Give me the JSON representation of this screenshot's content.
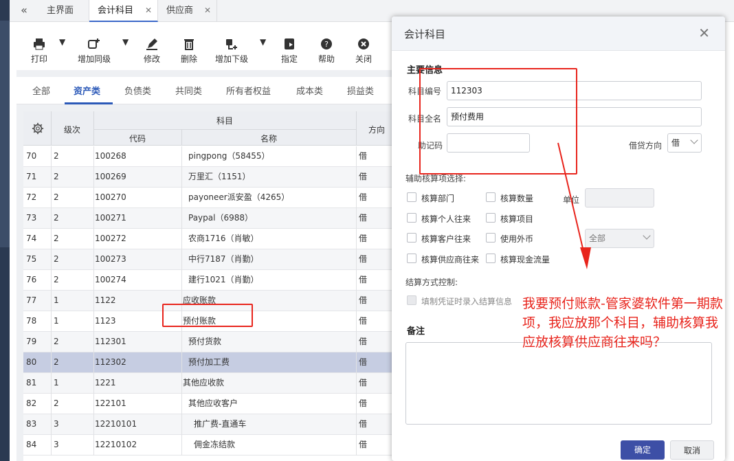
{
  "tabs": [
    {
      "label": "主界面",
      "closable": false
    },
    {
      "label": "会计科目",
      "closable": true,
      "active": true
    },
    {
      "label": "供应商",
      "closable": true
    }
  ],
  "toolbar": {
    "print": "打印",
    "add_same": "增加同级",
    "edit": "修改",
    "delete": "删除",
    "add_child": "增加下级",
    "assign": "指定",
    "help": "帮助",
    "close": "关闭"
  },
  "categories": [
    "全部",
    "资产类",
    "负债类",
    "共同类",
    "所有者权益",
    "成本类",
    "损益类"
  ],
  "grid": {
    "headers": {
      "level": "级次",
      "subject": "科目",
      "code": "代码",
      "name": "名称",
      "direction": "方向"
    },
    "rows": [
      {
        "no": "70",
        "level": "2",
        "code": "100268",
        "name": "pingpong（58455）",
        "dir": "借",
        "indent": 1
      },
      {
        "no": "71",
        "level": "2",
        "code": "100269",
        "name": "万里汇（1151）",
        "dir": "借",
        "indent": 1
      },
      {
        "no": "72",
        "level": "2",
        "code": "100270",
        "name": "payoneer派安盈（4265）",
        "dir": "借",
        "indent": 1
      },
      {
        "no": "73",
        "level": "2",
        "code": "100271",
        "name": "Paypal（6988）",
        "dir": "借",
        "indent": 1
      },
      {
        "no": "74",
        "level": "2",
        "code": "100272",
        "name": "农商1716（肖敏）",
        "dir": "借",
        "indent": 1
      },
      {
        "no": "75",
        "level": "2",
        "code": "100273",
        "name": "中行7187（肖勤）",
        "dir": "借",
        "indent": 1
      },
      {
        "no": "76",
        "level": "2",
        "code": "100274",
        "name": "建行1021（肖勤）",
        "dir": "借",
        "indent": 1
      },
      {
        "no": "77",
        "level": "1",
        "code": "1122",
        "name": "应收账款",
        "dir": "借",
        "indent": 0
      },
      {
        "no": "78",
        "level": "1",
        "code": "1123",
        "name": "预付账款",
        "dir": "借",
        "indent": 0
      },
      {
        "no": "79",
        "level": "2",
        "code": "112301",
        "name": "预付货款",
        "dir": "借",
        "indent": 1
      },
      {
        "no": "80",
        "level": "2",
        "code": "112302",
        "name": "预付加工费",
        "dir": "借",
        "indent": 1,
        "selected": true
      },
      {
        "no": "81",
        "level": "1",
        "code": "1221",
        "name": "其他应收款",
        "dir": "借",
        "indent": 0
      },
      {
        "no": "82",
        "level": "2",
        "code": "122101",
        "name": "其他应收客户",
        "dir": "借",
        "indent": 1
      },
      {
        "no": "83",
        "level": "3",
        "code": "12210101",
        "name": "推广费-直通车",
        "dir": "借",
        "indent": 2
      },
      {
        "no": "84",
        "level": "3",
        "code": "12210102",
        "name": "佣金冻结款",
        "dir": "借",
        "indent": 2
      }
    ]
  },
  "dialog": {
    "title": "会计科目",
    "main_info": "主要信息",
    "code_label": "科目编号",
    "code_value": "112303",
    "name_label": "科目全名",
    "name_value": "预付费用",
    "mnemonic_label": "助记码",
    "mnemonic_value": "",
    "direction_label": "借贷方向",
    "direction_value": "借",
    "aux_label": "辅助核算项选择:",
    "checks": [
      "核算部门",
      "核算个人往来",
      "核算客户往来",
      "核算供应商往来",
      "核算数量",
      "核算项目",
      "使用外币",
      "核算现金流量"
    ],
    "unit_label": "单位",
    "currency_value": "全部",
    "settle_label": "结算方式控制:",
    "settle_check": "填制凭证时录入结算信息",
    "memo_label": "备注",
    "ok": "确定",
    "cancel": "取消"
  },
  "annotation": "我要预付账款-管家婆软件第一期款项，我应放那个科目，辅助核算我应放核算供应商往来吗？",
  "colors": {
    "accent": "#2b59b8",
    "annotation": "#e8241c",
    "ok_button": "#3d4fa6",
    "selected_row": "#c6cde2"
  }
}
